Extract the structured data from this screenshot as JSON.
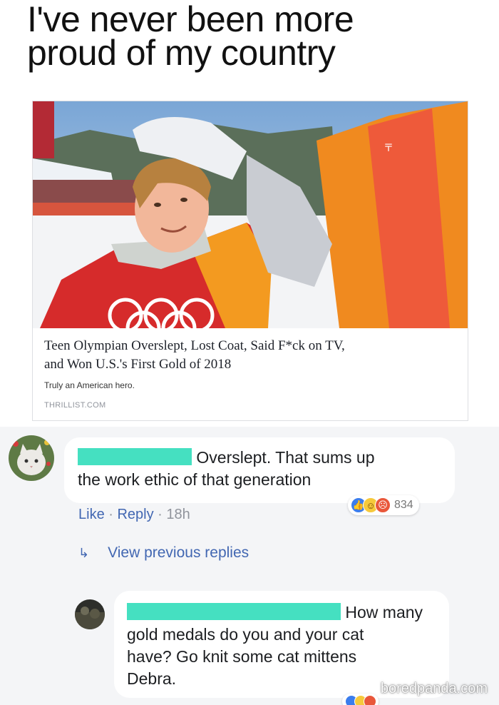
{
  "meme": {
    "title_line1": "I've never been more",
    "title_line2": "proud of my country"
  },
  "link_preview": {
    "headline_line1": "Teen Olympian Overslept, Lost Coat, Said F*ck on TV,",
    "headline_line2": "and Won U.S.'s First Gold of 2018",
    "description": "Truly an American hero.",
    "source": "THRILLIST.COM"
  },
  "comment1": {
    "text_line1": "Overslept. That sums up",
    "text_line2": "the work ethic of that generation",
    "actions": {
      "like": "Like",
      "separator1": " · ",
      "reply": "Reply",
      "separator2": " · ",
      "time": "18h"
    },
    "reactions": {
      "icons": [
        "like-icon",
        "haha-icon",
        "angry-icon"
      ],
      "count": "834"
    }
  },
  "view_previous_replies": "View previous replies",
  "reply1": {
    "text_line1": "How many",
    "text_line2": "gold medals do you and your cat",
    "text_line3": "have? Go knit some cat mittens",
    "text_line4": "Debra."
  },
  "watermark": "boredpanda.com",
  "colors": {
    "link_blue": "#4267b2",
    "redaction": "#45e0c1",
    "comments_bg": "#f4f5f7"
  }
}
